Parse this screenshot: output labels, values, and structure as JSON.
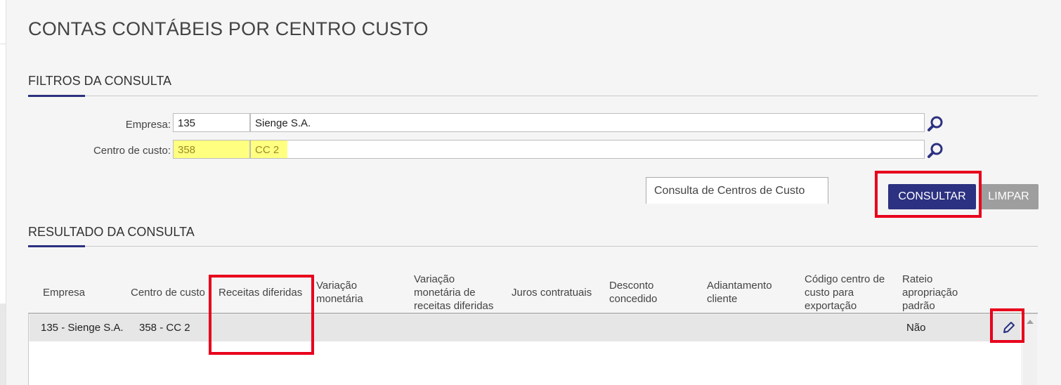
{
  "page": {
    "title": "CONTAS CONTÁBEIS POR CENTRO CUSTO"
  },
  "filters": {
    "section_title": "FILTROS DA CONSULTA",
    "empresa": {
      "label": "Empresa:",
      "code": "135",
      "name": "Sienge S.A."
    },
    "centro_custo": {
      "label": "Centro de custo:",
      "code": "358",
      "name": "CC 2"
    }
  },
  "tooltip": "Consulta de Centros de Custo",
  "actions": {
    "consultar": "CONSULTAR",
    "limpar": "LIMPAR"
  },
  "results": {
    "section_title": "RESULTADO DA CONSULTA",
    "columns": [
      [
        "Empresa"
      ],
      [
        "Centro de custo"
      ],
      [
        "Receitas diferidas"
      ],
      [
        "Variação",
        "monetária"
      ],
      [
        "Variação",
        "monetária de",
        "receitas diferidas"
      ],
      [
        "Juros contratuais"
      ],
      [
        "Desconto",
        "concedido"
      ],
      [
        "Adiantamento",
        "cliente"
      ],
      [
        "Código centro de",
        "custo para",
        "exportação"
      ],
      [
        "Rateio",
        "apropriação",
        "padrão"
      ]
    ],
    "rows": [
      {
        "empresa": "135 - Sienge S.A.",
        "centro": "358 - CC 2",
        "rateio": "Não"
      }
    ]
  },
  "colors": {
    "primary": "#2c3181",
    "highlight": "#ffff80",
    "annotation": "#e8001c",
    "secondary_button": "#9e9e9e"
  },
  "icons": {
    "search": "search-icon",
    "edit": "pencil-icon"
  }
}
